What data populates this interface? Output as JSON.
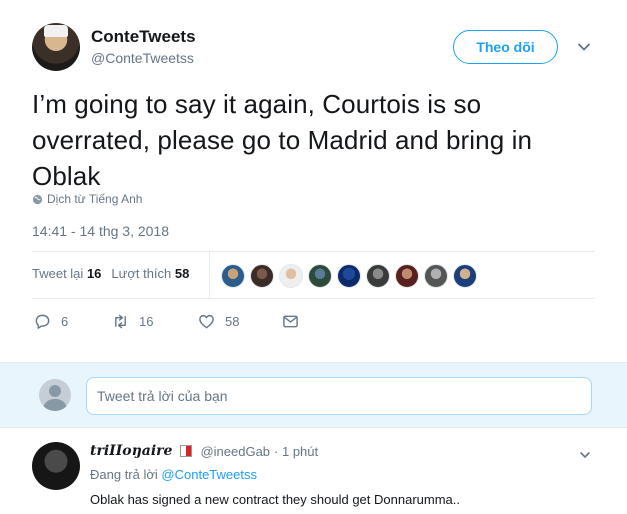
{
  "tweet": {
    "author_name": "ConteTweets",
    "author_handle": "@ConteTweetss",
    "follow_label": "Theo dõi",
    "text": "I’m going to say it again, Courtois is so overrated, please go to Madrid and bring in Oblak",
    "translate_label": "Dịch từ Tiếng Anh",
    "timestamp": "14:41 - 14 thg 3, 2018",
    "retweets_label": "Tweet lại",
    "retweets_count": "16",
    "likes_label": "Lượt thích",
    "likes_count": "58",
    "actions": {
      "replies": "6",
      "retweets": "16",
      "likes": "58"
    }
  },
  "reply_box": {
    "placeholder": "Tweet trả lời của bạn"
  },
  "reply": {
    "author_name": "triIIoŋaire",
    "handle": "@ineedGab",
    "time": "· 1 phút",
    "replying_to_label": "Đang trả lời",
    "replying_to_handle": "@ConteTweetss",
    "text": "Oblak has signed a new contract they should get Donnarumma.."
  },
  "colors": {
    "accent": "#1da1f2",
    "secondary_text": "#657786",
    "reply_bar_bg": "#e8f5fd"
  }
}
